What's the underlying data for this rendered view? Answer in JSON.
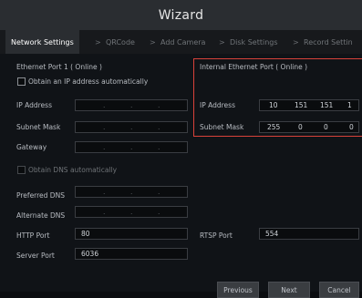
{
  "title": "Wizard",
  "steps": [
    "Network Settings",
    "QRCode",
    "Add Camera",
    "Disk Settings",
    "Record Settin"
  ],
  "step_separator": ">",
  "ethernet_port1": {
    "header": "Ethernet Port 1 ( Online )",
    "obtain_ip_label": "Obtain an IP address automatically",
    "ip_label": "IP Address",
    "subnet_label": "Subnet Mask",
    "gateway_label": "Gateway",
    "dot": "."
  },
  "dns": {
    "obtain_label": "Obtain DNS automatically",
    "preferred_label": "Preferred DNS",
    "alternate_label": "Alternate DNS"
  },
  "internal_port": {
    "header": "Internal Ethernet Port ( Online )",
    "ip_label": "IP Address",
    "ip": [
      "10",
      "151",
      "151",
      "1"
    ],
    "subnet_label": "Subnet Mask",
    "subnet": [
      "255",
      "0",
      "0",
      "0"
    ]
  },
  "ports": {
    "http_label": "HTTP Port",
    "http_value": "80",
    "rtsp_label": "RTSP Port",
    "rtsp_value": "554",
    "server_label": "Server Port",
    "server_value": "6036"
  },
  "buttons": {
    "previous": "Previous",
    "next": "Next",
    "cancel": "Cancel"
  }
}
